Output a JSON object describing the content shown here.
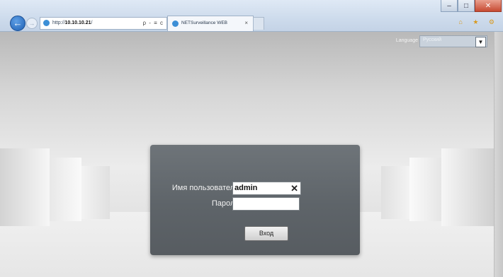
{
  "browser": {
    "address_prefix": "http://",
    "address_host": "10.10.10.21",
    "address_suffix": "/",
    "address_tools": "ρ - ≡ c",
    "tab_title": "NETSurveillance WEB",
    "tab_close": "×",
    "window_buttons": {
      "minimize": "–",
      "maximize": "□",
      "close": "✕"
    },
    "right_icons": "⌂ ★ ⚙"
  },
  "page": {
    "language_label": "Language",
    "language_value": "Русский",
    "login": {
      "username_label": "Имя пользователя",
      "username_value": "admin",
      "password_label": "Пароль",
      "password_value": "",
      "clear_glyph": "✕",
      "submit_label": "Вход"
    }
  },
  "colors": {
    "accent": "#1d5fb3",
    "panel": "#5e6469"
  }
}
